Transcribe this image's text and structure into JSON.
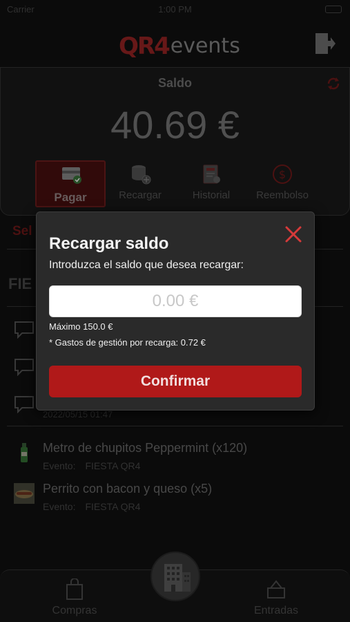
{
  "status_bar": {
    "carrier": "Carrier",
    "time": "1:00 PM"
  },
  "header": {
    "logo_mark": "QR4",
    "logo_text": "events"
  },
  "balance": {
    "label": "Saldo",
    "amount": "40.69 €",
    "actions": [
      {
        "label": "Pagar",
        "icon": "card-check-icon",
        "active": true
      },
      {
        "label": "Recargar",
        "icon": "coins-plus-icon",
        "active": false
      },
      {
        "label": "Historial",
        "icon": "receipt-icon",
        "active": false
      },
      {
        "label": "Reembolso",
        "icon": "dollar-refund-icon",
        "active": false
      }
    ]
  },
  "background_list": {
    "section_label": "Sel",
    "event_header": "FIE",
    "last_date": "2022/05/15 01:47",
    "purchases": [
      {
        "name": "Metro de chupitos Peppermint (x120)",
        "event_label": "Evento:",
        "event_name": "FIESTA QR4"
      },
      {
        "name": "Perrito con bacon y queso (x5)",
        "event_label": "Evento:",
        "event_name": "FIESTA QR4"
      }
    ]
  },
  "tabbar": {
    "left_label": "Compras",
    "right_label": "Entradas"
  },
  "modal": {
    "title": "Recargar saldo",
    "subtitle": "Introduzca el saldo que desea recargar:",
    "input_placeholder": "0.00 €",
    "input_value": "",
    "max_text": "Máximo 150.0 €",
    "fee_text": "* Gastos de gestión por recarga: 0.72 €",
    "confirm_label": "Confirmar"
  },
  "colors": {
    "accent": "#b01919",
    "close": "#d63a3a",
    "modal_bg": "#2a2a2a"
  }
}
